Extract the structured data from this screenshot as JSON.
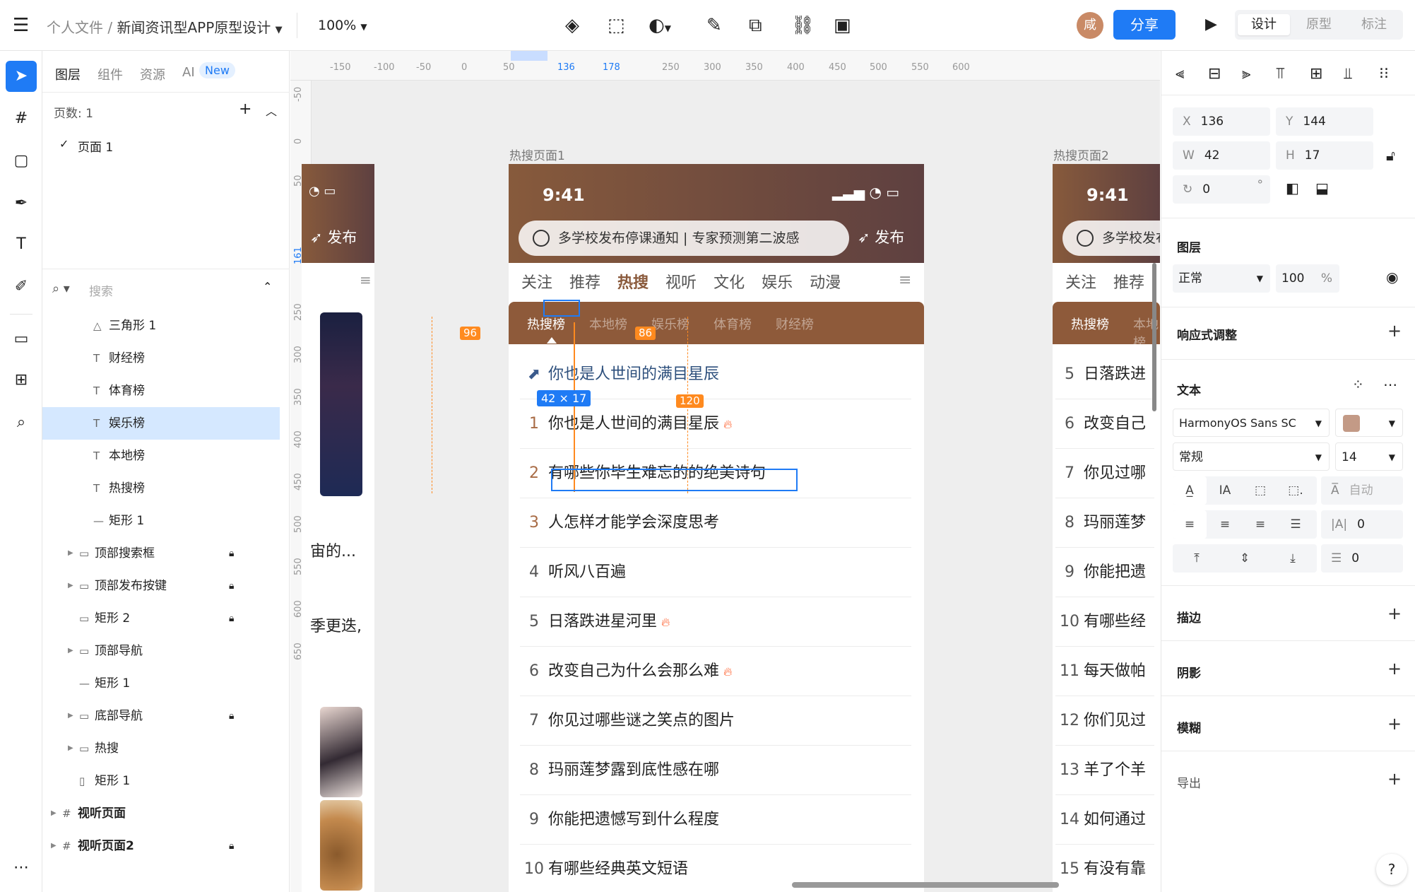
{
  "app": {
    "breadcrumb_root": "个人文件 /",
    "breadcrumb_file": "新闻资讯型APP原型设计",
    "zoom": "100%",
    "avatar_initial": "咸",
    "share_label": "分享",
    "modes": [
      "设计",
      "原型",
      "标注"
    ]
  },
  "left_panel": {
    "tabs": [
      "图层",
      "组件",
      "资源",
      "AI"
    ],
    "ai_badge": "New",
    "pages_label": "页数: 1",
    "page_item": "页面 1",
    "search_placeholder": "搜索",
    "layers": [
      {
        "icon": "triangle",
        "name": "三角形 1",
        "locked": false
      },
      {
        "icon": "text",
        "name": "财经榜",
        "locked": false
      },
      {
        "icon": "text",
        "name": "体育榜",
        "locked": false
      },
      {
        "icon": "text",
        "name": "娱乐榜",
        "locked": false,
        "selected": true
      },
      {
        "icon": "text",
        "name": "本地榜",
        "locked": false
      },
      {
        "icon": "text",
        "name": "热搜榜",
        "locked": false
      },
      {
        "icon": "line",
        "name": "矩形 1",
        "locked": false
      },
      {
        "icon": "folder",
        "name": "顶部搜索框",
        "locked": true
      },
      {
        "icon": "folder",
        "name": "顶部发布按键",
        "locked": true
      },
      {
        "icon": "rect",
        "name": "矩形 2",
        "locked": true
      },
      {
        "icon": "folder",
        "name": "顶部导航",
        "locked": false
      },
      {
        "icon": "line",
        "name": "矩形 1",
        "locked": false
      },
      {
        "icon": "folder",
        "name": "底部导航",
        "locked": true
      },
      {
        "icon": "folder",
        "name": "热搜",
        "locked": false
      },
      {
        "icon": "rect-v",
        "name": "矩形 1",
        "locked": false
      },
      {
        "icon": "frame",
        "name": "视听页面",
        "locked": false
      },
      {
        "icon": "frame",
        "name": "视听页面2",
        "locked": true
      }
    ]
  },
  "canvas": {
    "h_ruler": [
      "-150",
      "-100",
      "-50",
      "0",
      "50",
      "136",
      "178",
      "250",
      "300",
      "350",
      "400",
      "450",
      "500",
      "550",
      "600"
    ],
    "v_ruler": [
      "-50",
      "0",
      "50",
      "161",
      "250",
      "300",
      "350",
      "400",
      "450",
      "500",
      "550",
      "600",
      "650"
    ],
    "frame1_label": "热搜页面1",
    "frame2_label": "热搜页面2",
    "time": "9:41",
    "search_text": "多学校发布停课通知 | 专家预测第二波感",
    "publish_label": "发布",
    "nav_tabs": [
      "关注",
      "推荐",
      "热搜",
      "视听",
      "文化",
      "娱乐",
      "动漫"
    ],
    "sub_tabs": [
      "热搜榜",
      "本地榜",
      "娱乐榜",
      "体育榜",
      "财经榜"
    ],
    "pinned_item": "你也是人世间的满目星辰",
    "hot_list": [
      {
        "rank": "1",
        "title": "你也是人世间的满目星辰",
        "hot": true
      },
      {
        "rank": "2",
        "title": "有哪些你毕生难忘的的绝美诗句",
        "hot": false
      },
      {
        "rank": "3",
        "title": "人怎样才能学会深度思考",
        "hot": false
      },
      {
        "rank": "4",
        "title": "听风八百遍",
        "hot": false
      },
      {
        "rank": "5",
        "title": "日落跌进星河里",
        "hot": true
      },
      {
        "rank": "6",
        "title": "改变自己为什么会那么难",
        "hot": true
      },
      {
        "rank": "7",
        "title": "你见过哪些谜之笑点的图片",
        "hot": false
      },
      {
        "rank": "8",
        "title": "玛丽莲梦露到底性感在哪",
        "hot": false
      },
      {
        "rank": "9",
        "title": "你能把遗憾写到什么程度",
        "hot": false
      },
      {
        "rank": "10",
        "title": "有哪些经典英文短语",
        "hot": false
      }
    ],
    "frame2_list": [
      {
        "rank": "5",
        "title": "日落跌进"
      },
      {
        "rank": "6",
        "title": "改变自己"
      },
      {
        "rank": "7",
        "title": "你见过哪"
      },
      {
        "rank": "8",
        "title": "玛丽莲梦"
      },
      {
        "rank": "9",
        "title": "你能把遗"
      },
      {
        "rank": "10",
        "title": "有哪些经"
      },
      {
        "rank": "11",
        "title": "每天做帕"
      },
      {
        "rank": "12",
        "title": "你们见过"
      },
      {
        "rank": "13",
        "title": "羊了个羊"
      },
      {
        "rank": "14",
        "title": "如何通过"
      },
      {
        "rank": "15",
        "title": "有没有靠"
      }
    ],
    "frame0_texts": [
      "宙的...",
      "季更迭,"
    ],
    "measure_left": "96",
    "measure_right": "86",
    "measure_bottom": "120",
    "size_badge": "42 × 17"
  },
  "right_panel": {
    "x_label": "X",
    "x_value": "136",
    "y_label": "Y",
    "y_value": "144",
    "w_label": "W",
    "w_value": "42",
    "h_label": "H",
    "h_value": "17",
    "rotation": "0",
    "layer_title": "图层",
    "blend_mode": "正常",
    "opacity": "100",
    "opacity_unit": "%",
    "responsive_title": "响应式调整",
    "text_title": "文本",
    "font_family": "HarmonyOS Sans SC",
    "font_color": "#c39a86",
    "font_weight": "常规",
    "font_size": "14",
    "auto_label": "自动",
    "letter_spacing": "0",
    "paragraph_spacing": "0",
    "stroke_title": "描边",
    "shadow_title": "阴影",
    "blur_title": "模糊",
    "export_title": "导出"
  },
  "colors": {
    "accent": "#1f7bf5",
    "brand_brown": "#8e5a3a",
    "measure_orange": "#ff8a1f"
  }
}
